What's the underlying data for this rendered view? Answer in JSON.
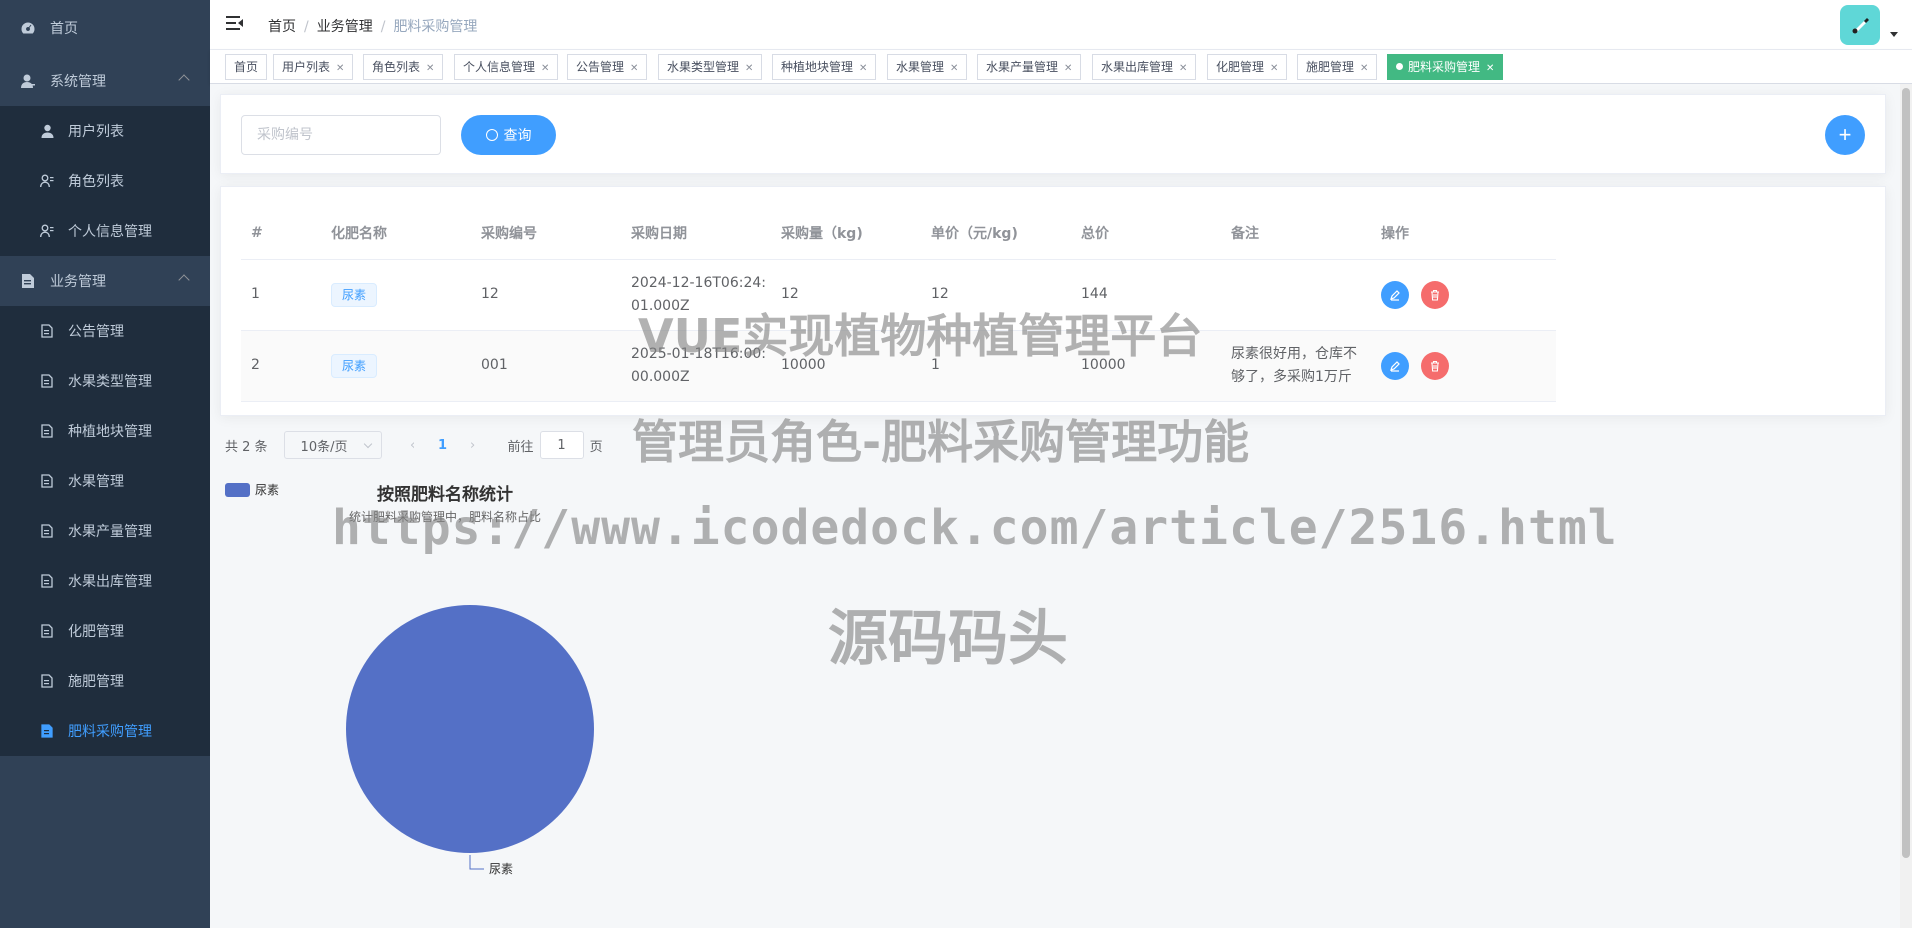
{
  "sidebar": {
    "home": "首页",
    "system": {
      "label": "系统管理",
      "items": [
        "用户列表",
        "角色列表",
        "个人信息管理"
      ]
    },
    "business": {
      "label": "业务管理",
      "items": [
        "公告管理",
        "水果类型管理",
        "种植地块管理",
        "水果管理",
        "水果产量管理",
        "水果出库管理",
        "化肥管理",
        "施肥管理",
        "肥料采购管理"
      ]
    },
    "active_item": "肥料采购管理"
  },
  "breadcrumb": [
    "首页",
    "业务管理",
    "肥料采购管理"
  ],
  "tags": [
    "首页",
    "用户列表",
    "角色列表",
    "个人信息管理",
    "公告管理",
    "水果类型管理",
    "种植地块管理",
    "水果管理",
    "水果产量管理",
    "水果出库管理",
    "化肥管理",
    "施肥管理",
    "肥料采购管理"
  ],
  "active_tag": "肥料采购管理",
  "search": {
    "placeholder": "采购编号",
    "query_label": "查询",
    "add_label": "+"
  },
  "table": {
    "headers": [
      "#",
      "化肥名称",
      "采购编号",
      "采购日期",
      "采购量（kg)",
      "单价（元/kg)",
      "总价",
      "备注",
      "操作"
    ],
    "rows": [
      {
        "index": "1",
        "name": "尿素",
        "code": "12",
        "date": "2024-12-16T06:24:01.000Z",
        "qty": "12",
        "price": "12",
        "total": "144",
        "note": ""
      },
      {
        "index": "2",
        "name": "尿素",
        "code": "001",
        "date": "2025-01-18T16:00:00.000Z",
        "qty": "10000",
        "price": "1",
        "total": "10000",
        "note": "尿素很好用，仓库不够了，多采购1万斤"
      }
    ]
  },
  "pagination": {
    "total_text": "共 2 条",
    "page_size": "10条/页",
    "current_page": "1",
    "goto_prefix": "前往",
    "goto_value": "1",
    "goto_suffix": "页"
  },
  "chart_data": {
    "type": "pie",
    "title": "按照肥料名称统计",
    "subtitle": "统计肥料采购管理中，肥料名称占比",
    "legend": [
      "尿素"
    ],
    "slices": [
      {
        "name": "尿素",
        "value": 2
      }
    ],
    "colors": [
      "#5470c6"
    ],
    "legend_placement": "top-left"
  },
  "watermark": {
    "line1": "VUE实现植物种植管理平台",
    "line2": "管理员角色-肥料采购管理功能",
    "line3": "https://www.icodedock.com/article/2516.html",
    "line4": "源码码头"
  },
  "colors": {
    "sidebar_bg": "#304156",
    "submenu_bg": "#1f2d3d",
    "primary": "#409eff",
    "danger": "#f56c6c",
    "active_tag": "#42b983"
  },
  "icons": {
    "home": "dashboard-icon",
    "system": "user-icon",
    "business": "document-icon"
  }
}
